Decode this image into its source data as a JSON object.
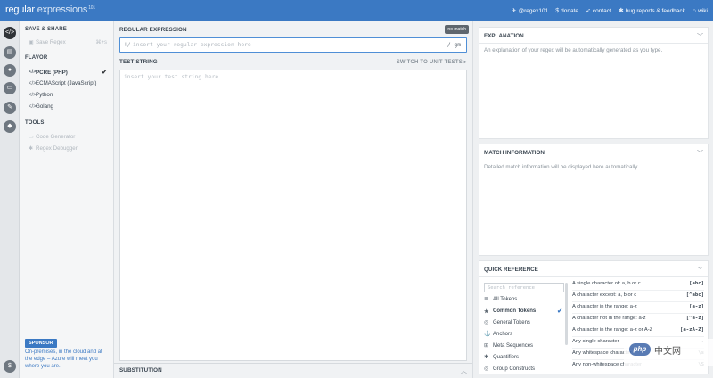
{
  "brand": {
    "part1": "regular",
    "part2": " expressions",
    "beta": "101"
  },
  "topbar": {
    "links": [
      {
        "icon": "twitter-icon",
        "glyph": "✈",
        "label": "@regex101"
      },
      {
        "icon": "dollar-icon",
        "glyph": "$",
        "label": "donate"
      },
      {
        "icon": "send-icon",
        "glyph": "➶",
        "label": "contact"
      },
      {
        "icon": "bug-icon",
        "glyph": "✱",
        "label": "bug reports & feedback"
      },
      {
        "icon": "bank-icon",
        "glyph": "⌂",
        "label": "wiki"
      }
    ]
  },
  "rail": {
    "buttons": [
      "regex-editor-icon",
      "library-icon",
      "account-icon",
      "controller-icon",
      "wrench-icon",
      "chat-icon",
      "donate-icon"
    ]
  },
  "sidebar": {
    "save_share_heading": "SAVE & SHARE",
    "save_regex": {
      "label": "Save Regex",
      "shortcut": "⌘+s"
    },
    "flavor_heading": "FLAVOR",
    "flavors": [
      {
        "label": "PCRE (PHP)",
        "selected": true
      },
      {
        "label": "ECMAScript (JavaScript)",
        "selected": false
      },
      {
        "label": "Python",
        "selected": false
      },
      {
        "label": "Golang",
        "selected": false
      }
    ],
    "tools_heading": "TOOLS",
    "tools": [
      {
        "label": "Code Generator"
      },
      {
        "label": "Regex Debugger"
      }
    ],
    "sponsor_badge": "SPONSOR",
    "sponsor_text": "On-premises, in the cloud and at the edge – Azure will meet you where you are."
  },
  "editor": {
    "regex_heading": "REGULAR EXPRESSION",
    "no_match": "no match",
    "delimiter": "!/",
    "regex_placeholder": "insert your regular expression here",
    "flags": "/ gm",
    "test_heading": "TEST STRING",
    "switch_label": "SWITCH TO UNIT TESTS ▸",
    "test_placeholder": "insert your test string here",
    "substitution_heading": "SUBSTITUTION"
  },
  "explanation": {
    "heading": "EXPLANATION",
    "description": "An explanation of your regex will be automatically generated as you type."
  },
  "match_info": {
    "heading": "MATCH INFORMATION",
    "description": "Detailed match information will be displayed here automatically."
  },
  "quick_reference": {
    "heading": "QUICK REFERENCE",
    "search_placeholder": "Search reference",
    "categories": [
      {
        "icon": "all-tokens-icon",
        "glyph": "≣",
        "label": "All Tokens",
        "selected": false
      },
      {
        "icon": "star-icon",
        "glyph": "★",
        "label": "Common Tokens",
        "selected": true
      },
      {
        "icon": "general-tokens-icon",
        "glyph": "◎",
        "label": "General Tokens",
        "selected": false
      },
      {
        "icon": "anchor-icon",
        "glyph": "⚓",
        "label": "Anchors",
        "selected": false
      },
      {
        "icon": "meta-sequences-icon",
        "glyph": "⊞",
        "label": "Meta Sequences",
        "selected": false
      },
      {
        "icon": "quantifiers-icon",
        "glyph": "✱",
        "label": "Quantifiers",
        "selected": false
      },
      {
        "icon": "group-constructs-icon",
        "glyph": "◎",
        "label": "Group Constructs",
        "selected": false
      }
    ],
    "tokens": [
      {
        "desc": "A single character of: a, b or c",
        "token": "[abc]"
      },
      {
        "desc": "A character except: a, b or c",
        "token": "[^abc]"
      },
      {
        "desc": "A character in the range: a-z",
        "token": "[a-z]"
      },
      {
        "desc": "A character not in the range: a-z",
        "token": "[^a-z]"
      },
      {
        "desc": "A character in the range: a-z or A-Z",
        "token": "[a-zA-Z]"
      },
      {
        "desc": "Any single character",
        "token": "."
      },
      {
        "desc": "Any whitespace character",
        "token": "\\s"
      },
      {
        "desc": "Any non-whitespace character",
        "token": "\\S"
      }
    ]
  },
  "watermark": {
    "logo": "php",
    "text": "中文网"
  }
}
